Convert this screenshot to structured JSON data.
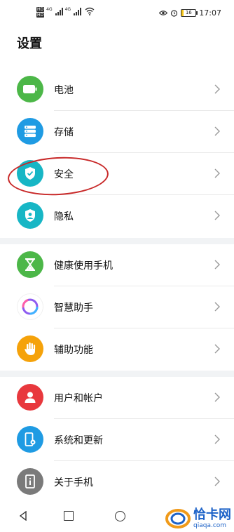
{
  "status_bar": {
    "net1": "HD",
    "net2": "HD",
    "tag1": "4G",
    "tag2": "4G",
    "battery_level": "16",
    "time": "17:07"
  },
  "page": {
    "title": "设置"
  },
  "groups": [
    {
      "items": [
        {
          "label": "电池",
          "icon": "battery-icon",
          "color": "#4cb748"
        },
        {
          "label": "存储",
          "icon": "storage-icon",
          "color": "#1f9be3"
        },
        {
          "label": "安全",
          "icon": "shield-icon",
          "color": "#17b6c5"
        },
        {
          "label": "隐私",
          "icon": "privacy-icon",
          "color": "#17b6c5"
        }
      ]
    },
    {
      "items": [
        {
          "label": "健康使用手机",
          "icon": "hourglass-icon",
          "color": "#4cb748"
        },
        {
          "label": "智慧助手",
          "icon": "assistant-icon",
          "color": "#ffffff"
        },
        {
          "label": "辅助功能",
          "icon": "hand-icon",
          "color": "#f5a20a"
        }
      ]
    },
    {
      "items": [
        {
          "label": "用户和帐户",
          "icon": "user-icon",
          "color": "#e8383d"
        },
        {
          "label": "系统和更新",
          "icon": "phone-gear-icon",
          "color": "#1f9be3"
        },
        {
          "label": "关于手机",
          "icon": "phone-info-icon",
          "color": "#7a7a7a"
        }
      ]
    }
  ],
  "watermark": {
    "title": "恰卡网",
    "url": "qiaqa.com"
  },
  "colors": {
    "accent_ring": "#c82828",
    "section_gap": "#f1f3f5"
  }
}
